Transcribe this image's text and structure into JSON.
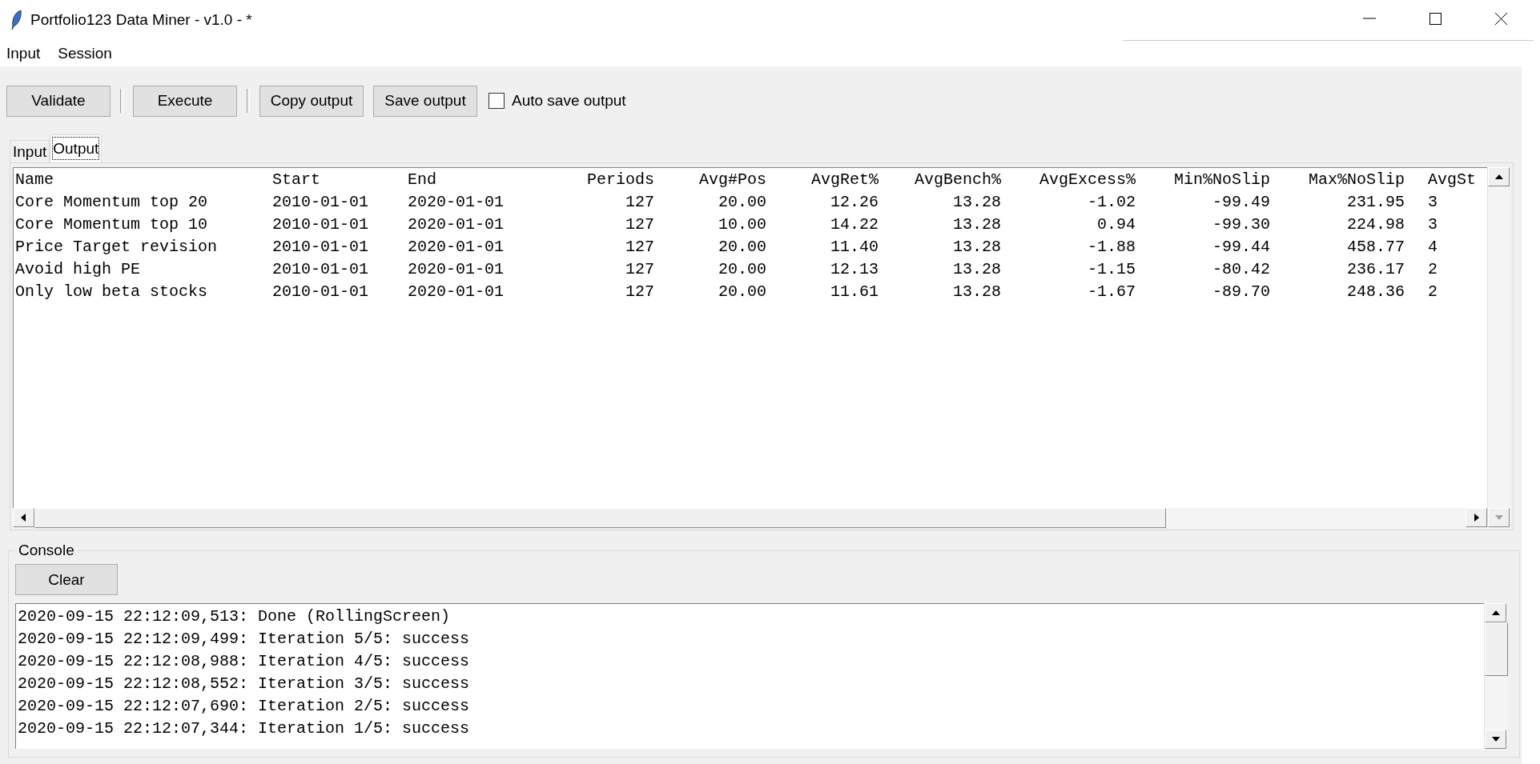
{
  "window": {
    "title": "Portfolio123 Data Miner - v1.0 - *"
  },
  "menu": [
    "Input",
    "Session"
  ],
  "toolbar": [
    {
      "kind": "button",
      "label": "Validate"
    },
    {
      "kind": "separator"
    },
    {
      "kind": "button",
      "label": "Execute"
    },
    {
      "kind": "separator"
    },
    {
      "kind": "button",
      "label": "Copy output"
    },
    {
      "kind": "button",
      "label": "Save output"
    },
    {
      "kind": "checkbox",
      "label": "Auto save output",
      "checked": false
    }
  ],
  "tabs": [
    {
      "label": "Input",
      "selected": false
    },
    {
      "label": "Output",
      "selected": true
    }
  ],
  "output": {
    "columns": [
      "Name",
      "Start",
      "End",
      "Periods",
      "Avg#Pos",
      "AvgRet%",
      "AvgBench%",
      "AvgExcess%",
      "Min%NoSlip",
      "Max%NoSlip",
      "AvgSt"
    ],
    "rows": [
      [
        "Core Momentum top 20",
        "2010-01-01",
        "2020-01-01",
        "127",
        "20.00",
        "12.26",
        "13.28",
        "-1.02",
        "-99.49",
        "231.95",
        "3"
      ],
      [
        "Core Momentum top 10",
        "2010-01-01",
        "2020-01-01",
        "127",
        "10.00",
        "14.22",
        "13.28",
        "0.94",
        "-99.30",
        "224.98",
        "3"
      ],
      [
        "Price Target revision",
        "2010-01-01",
        "2020-01-01",
        "127",
        "20.00",
        "11.40",
        "13.28",
        "-1.88",
        "-99.44",
        "458.77",
        "4"
      ],
      [
        "Avoid high PE",
        "2010-01-01",
        "2020-01-01",
        "127",
        "20.00",
        "12.13",
        "13.28",
        "-1.15",
        "-80.42",
        "236.17",
        "2"
      ],
      [
        "Only low beta stocks",
        "2010-01-01",
        "2020-01-01",
        "127",
        "20.00",
        "11.61",
        "13.28",
        "-1.67",
        "-89.70",
        "248.36",
        "2"
      ]
    ]
  },
  "console": {
    "title": "Console",
    "clear_button": "Clear",
    "lines": [
      "2020-09-15 22:12:09,513: Done (RollingScreen)",
      "2020-09-15 22:12:09,499: Iteration 5/5: success",
      "2020-09-15 22:12:08,988: Iteration 4/5: success",
      "2020-09-15 22:12:08,552: Iteration 3/5: success",
      "2020-09-15 22:12:07,690: Iteration 2/5: success",
      "2020-09-15 22:12:07,344: Iteration 1/5: success"
    ]
  }
}
